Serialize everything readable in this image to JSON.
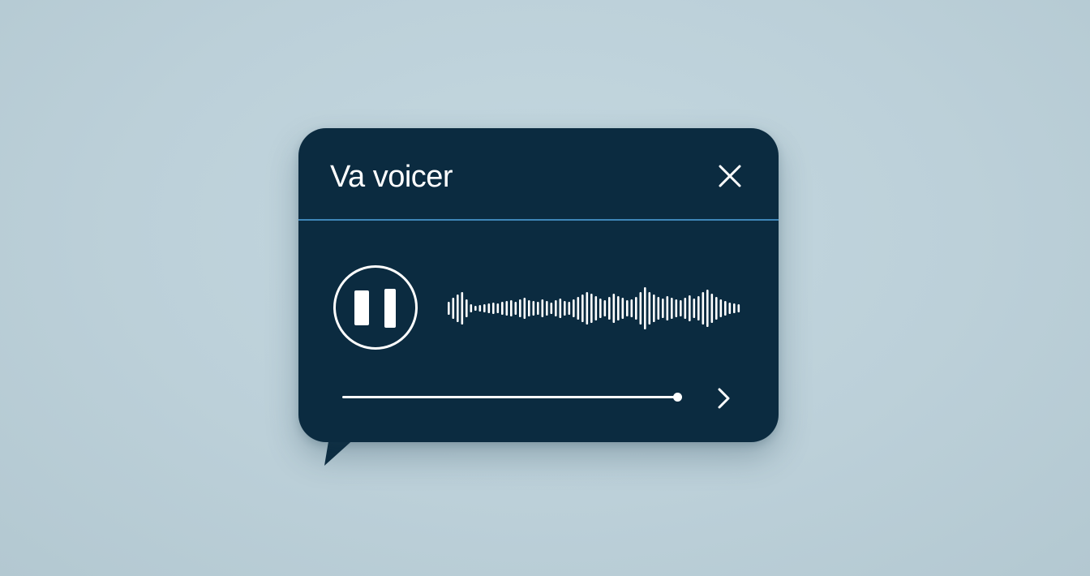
{
  "player": {
    "title": "Va voicer",
    "progress_fraction": 1.0,
    "icons": {
      "close": "close-icon",
      "pause": "pause-icon",
      "next": "chevron-right-icon"
    },
    "colors": {
      "background": "#bcd0d9",
      "panel": "#0b2b40",
      "divider": "#3f86b8",
      "foreground": "#ffffff"
    }
  }
}
